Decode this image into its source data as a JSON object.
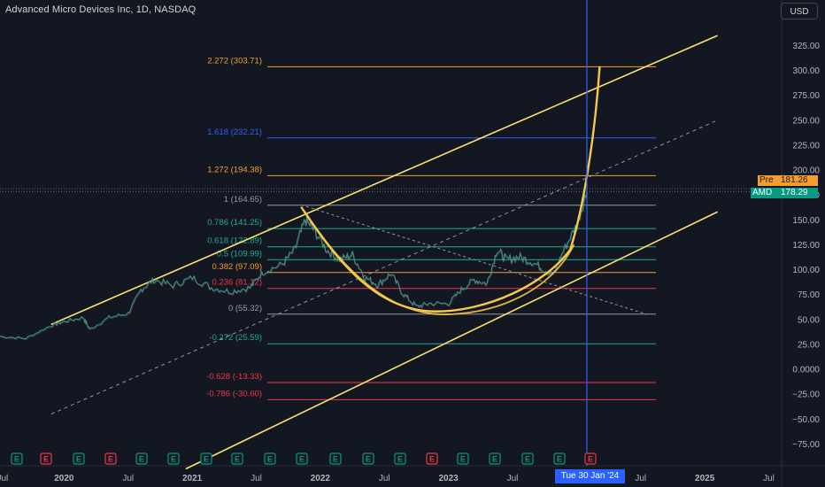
{
  "header": {
    "title": "Advanced Micro Devices Inc, 1D, NASDAQ",
    "currency_button": "USD"
  },
  "price_scale": {
    "ticks": [
      "325.00",
      "300.00",
      "275.00",
      "250.00",
      "225.00",
      "200.00",
      "175.00",
      "150.00",
      "125.00",
      "100.00",
      "75.00",
      "50.00",
      "25.00",
      "0.0000",
      "−25.00",
      "−50.00",
      "−75.00"
    ],
    "pre_label": "Pre",
    "pre_value": "181.26",
    "symbol_label": "AMD",
    "last_value": "178.29"
  },
  "time_axis": {
    "labels": [
      "Jul",
      "2020",
      "Jul",
      "2021",
      "Jul",
      "2022",
      "Jul",
      "2023",
      "Jul",
      "Tue 30 Jan '24",
      "Jul",
      "2025",
      "Jul"
    ],
    "crosshair_date": "Tue 30 Jan '24"
  },
  "earnings_markers": [
    {
      "label": "E",
      "kind": "positive"
    },
    {
      "label": "E",
      "kind": "negative"
    },
    {
      "label": "E",
      "kind": "positive"
    },
    {
      "label": "E",
      "kind": "negative"
    },
    {
      "label": "E",
      "kind": "positive"
    },
    {
      "label": "E",
      "kind": "positive"
    },
    {
      "label": "E",
      "kind": "positive"
    },
    {
      "label": "E",
      "kind": "positive"
    },
    {
      "label": "E",
      "kind": "positive"
    },
    {
      "label": "E",
      "kind": "positive"
    },
    {
      "label": "E",
      "kind": "positive"
    },
    {
      "label": "E",
      "kind": "positive"
    },
    {
      "label": "E",
      "kind": "positive"
    },
    {
      "label": "E",
      "kind": "negative"
    },
    {
      "label": "E",
      "kind": "positive"
    },
    {
      "label": "E",
      "kind": "positive"
    },
    {
      "label": "E",
      "kind": "positive"
    },
    {
      "label": "E",
      "kind": "positive"
    },
    {
      "label": "E",
      "kind": "negative"
    }
  ],
  "chart_data": {
    "type": "line",
    "ylim": [
      -85,
      340
    ],
    "y_ticks": [
      325,
      300,
      275,
      250,
      225,
      200,
      175,
      150,
      125,
      100,
      75,
      50,
      25,
      0,
      -25,
      -50,
      -75
    ],
    "fib_levels": [
      {
        "label": "2.272 (303.71)",
        "value": 303.71,
        "color": "#f59d2e"
      },
      {
        "label": "1.618 (232.21)",
        "value": 232.21,
        "color": "#2962ff"
      },
      {
        "label": "1.272 (194.38)",
        "value": 194.38,
        "color": "#f59d2e"
      },
      {
        "label": "1 (164.65)",
        "value": 164.65,
        "color": "#9598a1"
      },
      {
        "label": "0.786 (141.25)",
        "value": 141.25,
        "color": "#22ab94"
      },
      {
        "label": "0.618 (122.89)",
        "value": 122.89,
        "color": "#22ab94"
      },
      {
        "label": "0.5 (109.99)",
        "value": 109.99,
        "color": "#22ab94"
      },
      {
        "label": "0.382 (97.09)",
        "value": 97.09,
        "color": "#f59d2e"
      },
      {
        "label": "0.236 (81.12)",
        "value": 81.12,
        "color": "#f23645"
      },
      {
        "label": "0 (55.32)",
        "value": 55.32,
        "color": "#9598a1"
      },
      {
        "label": "-0.272 (25.59)",
        "value": 25.59,
        "color": "#22ab94"
      },
      {
        "label": "-0.628 (-13.33)",
        "value": -13.33,
        "color": "#f23645"
      },
      {
        "label": "-0.786 (-30.60)",
        "value": -30.6,
        "color": "#f23645"
      }
    ],
    "price_series": [
      {
        "t": 2019.5,
        "v": 33
      },
      {
        "t": 2019.7,
        "v": 31
      },
      {
        "t": 2019.9,
        "v": 44
      },
      {
        "t": 2020.0,
        "v": 48
      },
      {
        "t": 2020.15,
        "v": 52
      },
      {
        "t": 2020.2,
        "v": 40
      },
      {
        "t": 2020.35,
        "v": 52
      },
      {
        "t": 2020.5,
        "v": 56
      },
      {
        "t": 2020.6,
        "v": 80
      },
      {
        "t": 2020.7,
        "v": 90
      },
      {
        "t": 2020.85,
        "v": 84
      },
      {
        "t": 2021.0,
        "v": 92
      },
      {
        "t": 2021.15,
        "v": 82
      },
      {
        "t": 2021.3,
        "v": 78
      },
      {
        "t": 2021.45,
        "v": 82
      },
      {
        "t": 2021.55,
        "v": 98
      },
      {
        "t": 2021.7,
        "v": 105
      },
      {
        "t": 2021.8,
        "v": 120
      },
      {
        "t": 2021.88,
        "v": 150
      },
      {
        "t": 2021.95,
        "v": 140
      },
      {
        "t": 2022.05,
        "v": 120
      },
      {
        "t": 2022.15,
        "v": 110
      },
      {
        "t": 2022.25,
        "v": 115
      },
      {
        "t": 2022.35,
        "v": 92
      },
      {
        "t": 2022.45,
        "v": 85
      },
      {
        "t": 2022.55,
        "v": 96
      },
      {
        "t": 2022.65,
        "v": 75
      },
      {
        "t": 2022.75,
        "v": 63
      },
      {
        "t": 2022.85,
        "v": 66
      },
      {
        "t": 2023.0,
        "v": 66
      },
      {
        "t": 2023.1,
        "v": 80
      },
      {
        "t": 2023.2,
        "v": 90
      },
      {
        "t": 2023.3,
        "v": 86
      },
      {
        "t": 2023.38,
        "v": 120
      },
      {
        "t": 2023.45,
        "v": 110
      },
      {
        "t": 2023.55,
        "v": 113
      },
      {
        "t": 2023.65,
        "v": 108
      },
      {
        "t": 2023.75,
        "v": 100
      },
      {
        "t": 2023.82,
        "v": 95
      },
      {
        "t": 2023.9,
        "v": 120
      },
      {
        "t": 2024.0,
        "v": 145
      },
      {
        "t": 2024.08,
        "v": 178.29
      }
    ],
    "annotations": {
      "parallel_channel": {
        "upper_start": {
          "t": 2019.9,
          "v": 45
        },
        "upper_end": {
          "t": 2025.1,
          "v": 335
        },
        "lower_start": {
          "t": 2020.95,
          "v": -100
        },
        "lower_end": {
          "t": 2025.1,
          "v": 158
        },
        "mid_start": {
          "t": 2019.9,
          "v": -45
        },
        "mid_end": {
          "t": 2025.1,
          "v": 250
        }
      },
      "cup_curve": "rounded bottom from 2021.85 (164) to 2022.90 (55) rising to 2024.18 (304)",
      "trend_line_dashed": {
        "from": {
          "t": 2021.85,
          "v": 165
        },
        "to": {
          "t": 2024.55,
          "v": 55
        }
      },
      "crosshair_time": 2024.08
    }
  }
}
